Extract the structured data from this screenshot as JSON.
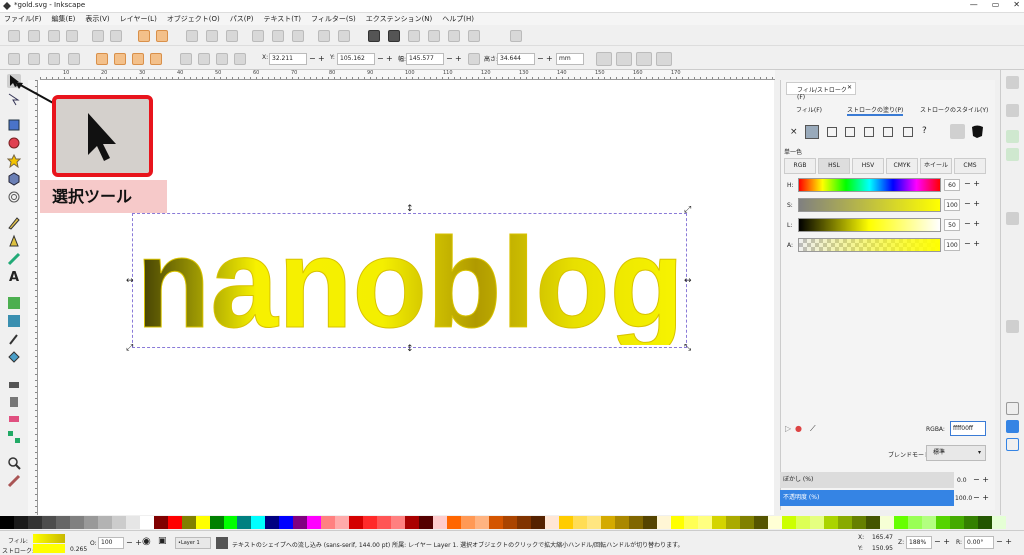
{
  "window": {
    "title": "*gold.svg - Inkscape",
    "min": "—",
    "max": "▭",
    "close": "✕"
  },
  "menu": [
    "ファイル(F)",
    "編集(E)",
    "表示(V)",
    "レイヤー(L)",
    "オブジェクト(O)",
    "パス(P)",
    "テキスト(T)",
    "フィルター(S)",
    "エクステンション(N)",
    "ヘルプ(H)"
  ],
  "coords": {
    "x_label": "X:",
    "x": "32.211",
    "y_label": "Y:",
    "y": "105.162",
    "w_label": "幅:",
    "w": "145.577",
    "h_label": "高さ:",
    "h": "34.644",
    "unit": "mm"
  },
  "ruler_labels": [
    "10",
    "20",
    "30",
    "40",
    "50",
    "60",
    "70",
    "80",
    "90",
    "100",
    "110",
    "120",
    "130",
    "140",
    "150",
    "160",
    "170"
  ],
  "canvas": {
    "word": "nanoblog",
    "callout": "選択ツール",
    "accent": "#e8141c"
  },
  "panel": {
    "header": "フィル/ストローク(F)",
    "close": "✕",
    "tabs": [
      "フィル(F)",
      "ストロークの塗り(P)",
      "ストロークのスタイル(Y)"
    ],
    "paint_x": "×",
    "paint_q": "?",
    "flat_label": "単一色",
    "modes": [
      "RGB",
      "HSL",
      "HSV",
      "CMYK",
      "ホイール",
      "CMS"
    ],
    "sliders": [
      {
        "label": "H:",
        "value": "60"
      },
      {
        "label": "S:",
        "value": "100"
      },
      {
        "label": "L:",
        "value": "50"
      },
      {
        "label": "A:",
        "value": "100"
      }
    ],
    "rgba_label": "RGBA:",
    "rgba_value": "ffff00ff",
    "blend_label": "ブレンドモード:",
    "blend_value": "標準",
    "blur_label": "ぼかし (%)",
    "blur_value": "0.0",
    "opacity_label": "不透明度 (%)",
    "opacity_value": "100.0"
  },
  "status": {
    "fill_label": "フィル:",
    "stroke_label": "ストローク:",
    "stroke_width": "0.265",
    "o_label": "O:",
    "opacity": "100",
    "layer": "•Layer 1",
    "message": "テキストのシェイプへの流し込み (sans-serif, 144.00 pt) 所属: レイヤー Layer 1. 選択オブジェクトのクリックで拡大縮小ハンドル/回転ハンドルが切り替わります。",
    "x_label": "X:",
    "x": "165.47",
    "y_label": "Y:",
    "y": "150.95",
    "z_label": "Z:",
    "zoom": "188%",
    "r_label": "R:",
    "rotate": "0.00°"
  },
  "palette": [
    "#000000",
    "#1a1a1a",
    "#333333",
    "#4d4d4d",
    "#666666",
    "#808080",
    "#999999",
    "#b3b3b3",
    "#cccccc",
    "#e6e6e6",
    "#ffffff",
    "#800000",
    "#ff0000",
    "#808000",
    "#ffff00",
    "#008000",
    "#00ff00",
    "#008080",
    "#00ffff",
    "#000080",
    "#0000ff",
    "#800080",
    "#ff00ff",
    "#ff8080",
    "#ffaaaa",
    "#d40000",
    "#ff2a2a",
    "#ff5555",
    "#ff8080",
    "#aa0000",
    "#550000",
    "#ffcccc",
    "#ff6600",
    "#ff9955",
    "#ffb380",
    "#d45500",
    "#aa4400",
    "#803300",
    "#552200",
    "#ffe6d5",
    "#ffcc00",
    "#ffdd55",
    "#ffe680",
    "#d4aa00",
    "#aa8800",
    "#806600",
    "#554400",
    "#fff6d5",
    "#ffff00",
    "#ffff55",
    "#ffff80",
    "#d4d400",
    "#aaaa00",
    "#808000",
    "#555500",
    "#ffffd5",
    "#ccff00",
    "#ddff55",
    "#e5ff80",
    "#aad400",
    "#88aa00",
    "#668000",
    "#445500",
    "#f6ffd5",
    "#66ff00",
    "#99ff55",
    "#b3ff80",
    "#55d400",
    "#44aa00",
    "#338000",
    "#225500",
    "#e5ffd5"
  ]
}
